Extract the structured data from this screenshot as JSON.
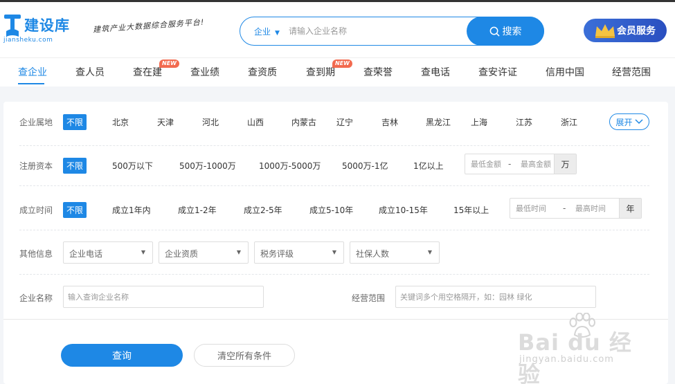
{
  "header": {
    "logo_text": "建设库",
    "logo_sub": "jiansheku.com",
    "slogan": "建筑产业大数据综合服务平台!",
    "search": {
      "type_label": "企业",
      "placeholder": "请输入企业名称",
      "button_label": "搜索"
    },
    "vip_label": "会员服务"
  },
  "nav": {
    "items": [
      {
        "label": "查企业"
      },
      {
        "label": "查人员"
      },
      {
        "label": "查在建",
        "badge": "NEW"
      },
      {
        "label": "查业绩"
      },
      {
        "label": "查资质"
      },
      {
        "label": "查到期",
        "badge": "NEW"
      },
      {
        "label": "查荣誉"
      },
      {
        "label": "查电话"
      },
      {
        "label": "查安许证"
      },
      {
        "label": "信用中国"
      },
      {
        "label": "经营范围"
      }
    ],
    "active_index": 0
  },
  "filters": {
    "region": {
      "label": "企业属地",
      "options": [
        "不限",
        "北京",
        "天津",
        "河北",
        "山西",
        "内蒙古",
        "辽宁",
        "吉林",
        "黑龙江",
        "上海",
        "江苏",
        "浙江"
      ],
      "expand_label": "展开"
    },
    "capital": {
      "label": "注册资本",
      "options": [
        "不限",
        "500万以下",
        "500万-1000万",
        "1000万-5000万",
        "5000万-1亿",
        "1亿以上"
      ],
      "min_placeholder": "最低金额",
      "sep": "-",
      "max_placeholder": "最高金额",
      "unit": "万"
    },
    "founded": {
      "label": "成立时间",
      "options": [
        "不限",
        "成立1年内",
        "成立1-2年",
        "成立2-5年",
        "成立5-10年",
        "成立10-15年",
        "15年以上"
      ],
      "min_placeholder": "最低时间",
      "sep": "-",
      "max_placeholder": "最高时间",
      "unit": "年"
    },
    "other": {
      "label": "其他信息",
      "selects": [
        "企业电话",
        "企业资质",
        "税务评级",
        "社保人数"
      ]
    },
    "name": {
      "label": "企业名称",
      "placeholder": "输入查询企业名称",
      "scope_label": "经营范围",
      "scope_placeholder": "关键词多个用空格隔开，如：园林 绿化"
    }
  },
  "actions": {
    "query_label": "查询",
    "clear_label": "清空所有条件"
  },
  "watermark": {
    "main": "Bai du 经验",
    "url": "jingyan.baidu.com"
  },
  "colors": {
    "accent": "#1e88e5",
    "badge": "#f26a4f",
    "vip": "#2a4fc0"
  }
}
